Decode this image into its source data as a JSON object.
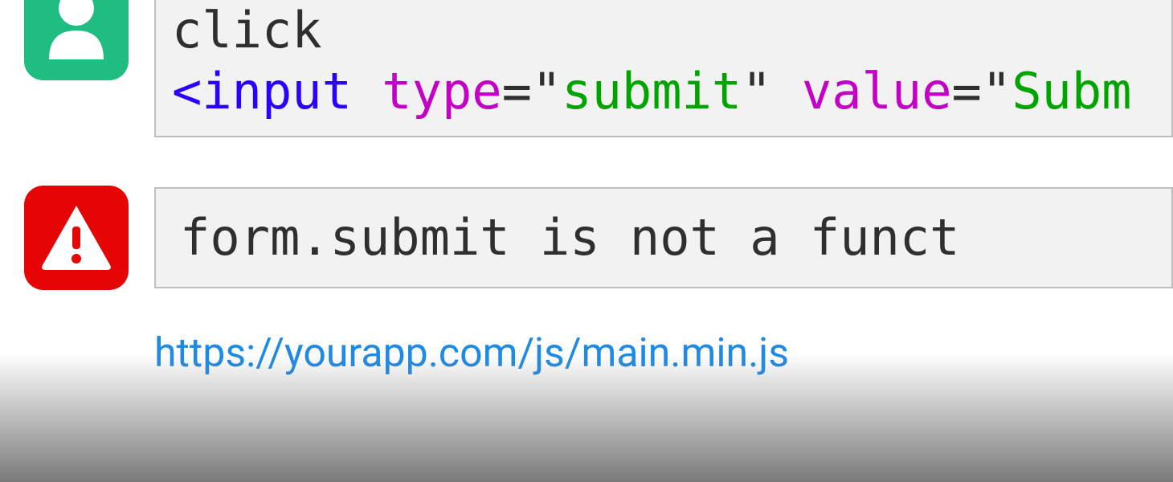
{
  "clickBlock": {
    "line1": "click",
    "tagOpen": "<input",
    "attr1_name": "type",
    "attr1_eqQuoteOpen": "=\"",
    "attr1_value": "submit",
    "attr1_quoteClose": "\"",
    "attr2_name": "value",
    "attr2_eqQuoteOpen": "=\"",
    "attr2_value": "Subm"
  },
  "errorBlock": {
    "message": "form.submit is not a funct"
  },
  "source": {
    "url": "https://yourapp.com/js/main.min.js"
  }
}
